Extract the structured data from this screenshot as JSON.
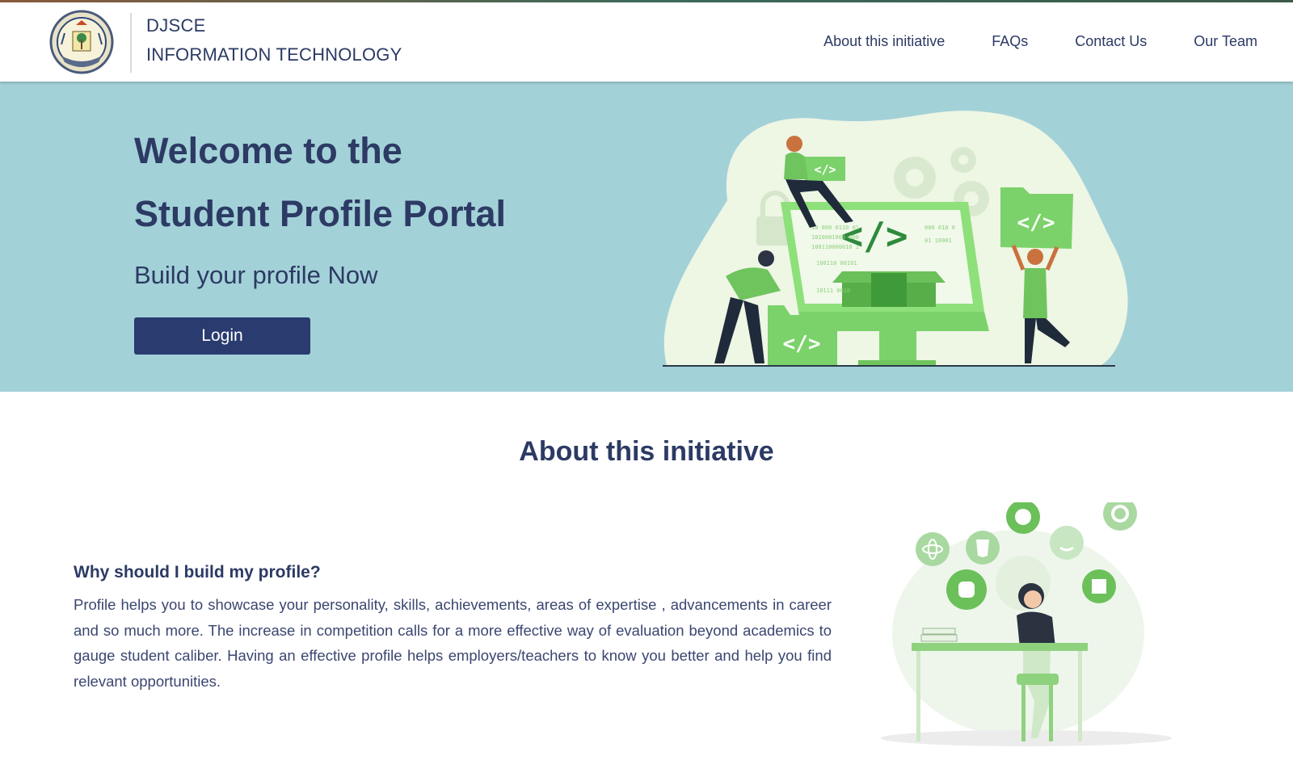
{
  "header": {
    "brand_line1": "DJSCE",
    "brand_line2": "INFORMATION TECHNOLOGY",
    "nav": [
      {
        "label": "About this initiative"
      },
      {
        "label": "FAQs"
      },
      {
        "label": "Contact Us"
      },
      {
        "label": "Our Team"
      }
    ]
  },
  "hero": {
    "title_line1": "Welcome to the",
    "title_line2": "Student Profile Portal",
    "subtitle": "Build your profile Now",
    "login_label": "Login",
    "code_tag": "</>"
  },
  "about": {
    "title": "About this initiative",
    "question": "Why should I build my profile?",
    "body": "Profile helps you to showcase your personality, skills, achievements, areas of expertise , advancements in career and so much more. The increase in competition calls for a more effective way of evaluation beyond academics to gauge student caliber. Having an effective profile helps employers/teachers to know you better and help you find relevant opportunities."
  },
  "colors": {
    "navy": "#2c3a64",
    "button": "#2a3b70",
    "hero_bg": "#a3d1d8",
    "illustration_green": "#7fd16f"
  }
}
